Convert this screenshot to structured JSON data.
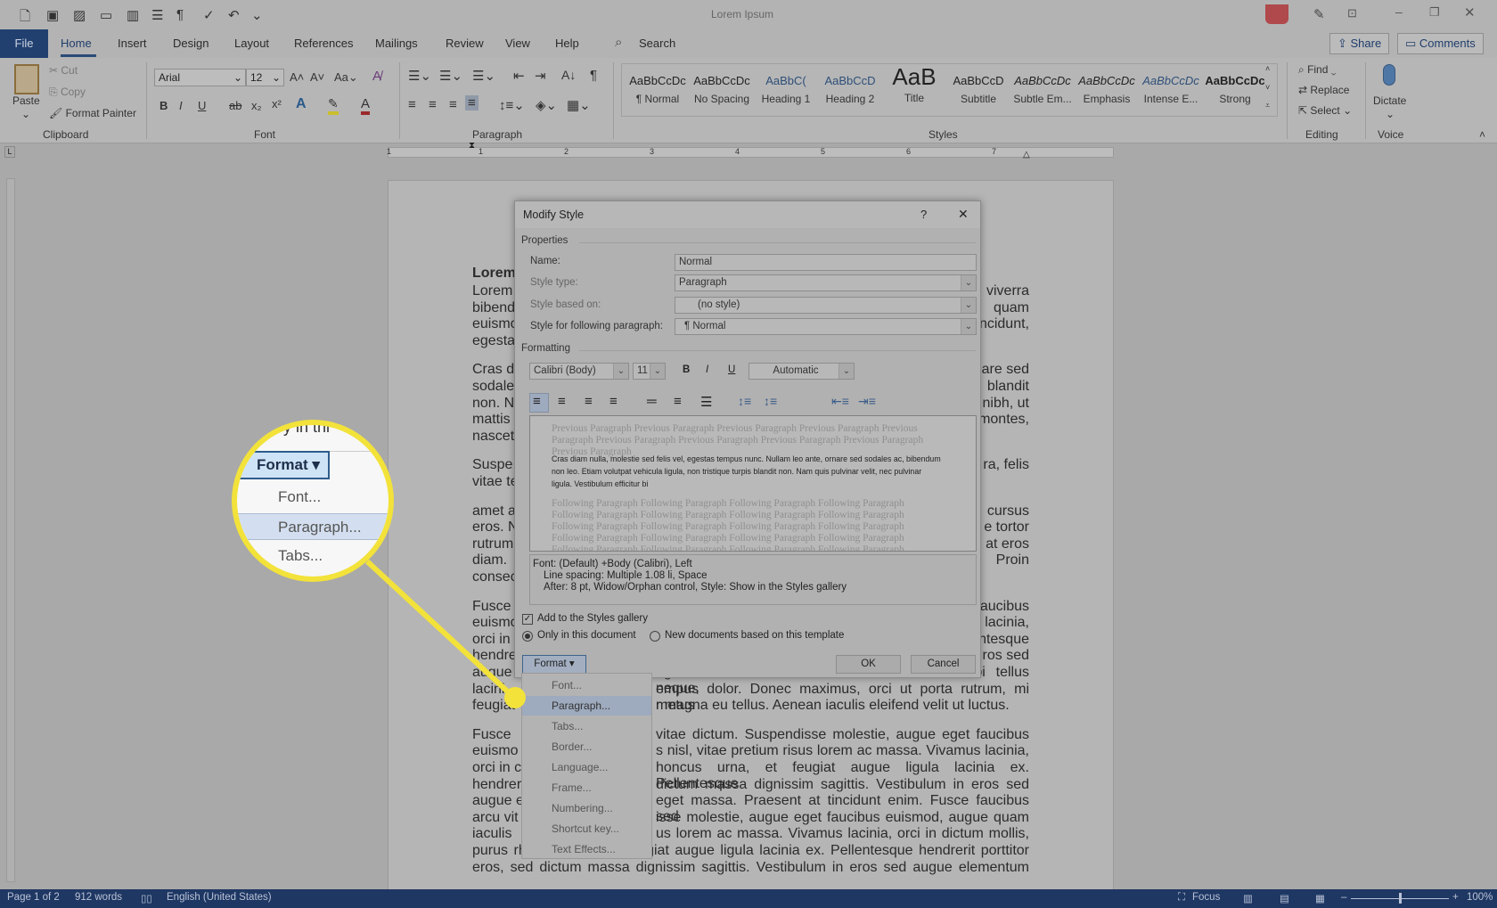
{
  "window": {
    "title": "Lorem Ipsum"
  },
  "quick_access": [
    {
      "icon": "new-document-icon",
      "glyph": "🗋"
    },
    {
      "icon": "save-icon",
      "glyph": "▣"
    },
    {
      "icon": "save-as-icon",
      "glyph": "▨"
    },
    {
      "icon": "open-folder-icon",
      "glyph": "▭"
    },
    {
      "icon": "read-mode-icon",
      "glyph": "▥"
    },
    {
      "icon": "print-layout-icon",
      "glyph": "☰"
    },
    {
      "icon": "pilcrow-icon",
      "glyph": "¶"
    },
    {
      "icon": "spelling-icon",
      "glyph": "✓"
    },
    {
      "icon": "undo-icon",
      "glyph": "↶"
    },
    {
      "icon": "customize-icon",
      "glyph": "⌄"
    }
  ],
  "tabs": {
    "file": "File",
    "items": [
      "Home",
      "Insert",
      "Design",
      "Layout",
      "References",
      "Mailings",
      "Review",
      "View",
      "Help"
    ],
    "active": "Home",
    "search": "Search"
  },
  "header_buttons": {
    "share": "Share",
    "comments": "Comments"
  },
  "clipboard": {
    "paste": "Paste",
    "cut": "Cut",
    "copy": "Copy",
    "format_painter": "Format Painter",
    "label": "Clipboard"
  },
  "font": {
    "name": "Arial",
    "size": "12",
    "label": "Font",
    "case": "Aa"
  },
  "paragraph": {
    "label": "Paragraph"
  },
  "styles": {
    "label": "Styles",
    "items": [
      {
        "preview": "AaBbCcDc",
        "name": "¶ Normal"
      },
      {
        "preview": "AaBbCcDc",
        "name": "No Spacing"
      },
      {
        "preview": "AaBbC(",
        "name": "Heading 1"
      },
      {
        "preview": "AaBbCcD",
        "name": "Heading 2"
      },
      {
        "preview": "AaB",
        "name": "Title"
      },
      {
        "preview": "AaBbCcD",
        "name": "Subtitle"
      },
      {
        "preview": "AaBbCcDc",
        "name": "Subtle Em..."
      },
      {
        "preview": "AaBbCcDc",
        "name": "Emphasis"
      },
      {
        "preview": "AaBbCcDc",
        "name": "Intense E..."
      },
      {
        "preview": "AaBbCcDc",
        "name": "Strong"
      }
    ]
  },
  "editing": {
    "find": "Find",
    "replace": "Replace",
    "select": "Select",
    "label": "Editing"
  },
  "voice": {
    "dictate": "Dictate",
    "label": "Voice"
  },
  "ruler": [
    "1",
    "1",
    "2",
    "3",
    "4",
    "5",
    "6",
    "7"
  ],
  "document": {
    "heading": "Lorem",
    "lines": [
      {
        "l": "Lorem",
        "r": "viverra"
      },
      {
        "l": "bibend",
        "r": "quam"
      },
      {
        "l": "euismo",
        "r": "tincidunt,"
      },
      {
        "l": "egesta",
        "r": ""
      },
      {
        "l": "Cras d",
        "r": "are sed"
      },
      {
        "l": "sodale",
        "r": "blandit"
      },
      {
        "l": "non. N",
        "r": "nibh, ut"
      },
      {
        "l": "mattis",
        "r": "montes,"
      },
      {
        "l": "nascet",
        "r": ""
      },
      {
        "l": "Suspe",
        "r": "ra, felis"
      },
      {
        "l": "vitae te",
        "r": ""
      },
      {
        "l": "amet a",
        "r": "cursus"
      },
      {
        "l": "eros. N",
        "r": "e tortor"
      },
      {
        "l": "rutrum",
        "r": "at eros"
      },
      {
        "l": "diam.",
        "r": "Proin"
      },
      {
        "l": "consec",
        "r": ""
      },
      {
        "l": "Fusce",
        "r": "aucibus"
      },
      {
        "l": "euismo",
        "r": "lacinia,"
      },
      {
        "l": "orci in",
        "r": "ntesque"
      },
      {
        "l": "hendre",
        "r": "ros sed"
      },
      {
        "l": "augue e",
        "r": "eget massa. Praesent at tincidunt enim. Morbi tellus neque,"
      },
      {
        "l": "lacini",
        "r": "empus dolor. Donec maximus, orci ut porta rutrum, mi metus"
      },
      {
        "l": "feugiat",
        "r": "r magna eu tellus. Aenean iaculis eleifend velit ut luctus."
      },
      {
        "l": "Fusce",
        "r": "vitae dictum. Suspendisse molestie, augue eget faucibus"
      },
      {
        "l": "euismo",
        "r": "s nisl, vitae pretium risus lorem ac massa. Vivamus lacinia,"
      },
      {
        "l": "orci in c",
        "r": "honcus urna, et feugiat augue ligula lacinia ex. Pellentesque"
      },
      {
        "l": "hendrer",
        "r": "dictum massa dignissim sagittis. Vestibulum in eros sed"
      },
      {
        "l": "augue e",
        "r": "eget massa. Praesent at tincidunt enim. Fusce faucibus sed"
      },
      {
        "l": "arcu vit",
        "r": "isse molestie, augue eget faucibus euismod, augue quam"
      },
      {
        "l": "iaculis",
        "r": "us lorem ac massa. Vivamus lacinia, orci in dictum mollis,"
      },
      {
        "l": "purus rhoncus urna, et feugiat augue ligula lacinia ex. Pellentesque hendrerit porttitor",
        "r": ""
      },
      {
        "l": "eros, sed dictum massa dignissim sagittis. Vestibulum in eros sed augue elementum",
        "r": ""
      }
    ]
  },
  "dialog": {
    "title": "Modify Style",
    "help": "?",
    "close": "✕",
    "properties": "Properties",
    "name_label": "Name:",
    "name_value": "Normal",
    "style_type_label": "Style type:",
    "style_type_value": "Paragraph",
    "based_on_label": "Style based on:",
    "based_on_value": "(no style)",
    "following_label": "Style for following paragraph:",
    "following_value": "¶  Normal",
    "formatting": "Formatting",
    "font": "Calibri (Body)",
    "size": "11",
    "bold": "B",
    "italic": "I",
    "underline": "U",
    "color": "Automatic",
    "preview_previous": "Previous Paragraph Previous Paragraph Previous Paragraph Previous Paragraph Previous Paragraph Previous Paragraph Previous Paragraph Previous Paragraph Previous Paragraph Previous Paragraph",
    "preview_sample": "Cras diam nulla, molestie sed felis vel, egestas tempus nunc. Nullam leo ante, ornare sed sodales ac, bibendum non leo. Etiam volutpat vehicula ligula, non tristique turpis blandit non. Nam quis pulvinar velit, nec pulvinar ligula. Vestibulum efficitur bi",
    "preview_following": "Following Paragraph Following Paragraph Following Paragraph Following Paragraph Following Paragraph Following Paragraph Following Paragraph Following Paragraph Following Paragraph Following Paragraph Following Paragraph Following Paragraph Following Paragraph Following Paragraph Following Paragraph Following Paragraph Following Paragraph Following Paragraph Following Paragraph Following Paragraph Following Paragraph Following Paragraph Following Paragraph Following Paragraph Following Paragraph",
    "description": [
      "Font: (Default) +Body (Calibri), Left",
      "Line spacing:  Multiple 1.08 li, Space",
      "After:  8 pt, Widow/Orphan control, Style: Show in the Styles gallery"
    ],
    "add_gallery": "Add to the Styles gallery",
    "add_gallery_checked": true,
    "only_doc": "Only in this document",
    "new_docs": "New documents based on this template",
    "scope_selected": "Only in this document",
    "format": "Format",
    "ok": "OK",
    "cancel": "Cancel"
  },
  "format_menu": {
    "items": [
      "Font...",
      "Paragraph...",
      "Tabs...",
      "Border...",
      "Language...",
      "Frame...",
      "Numbering...",
      "Shortcut key...",
      "Text Effects..."
    ],
    "highlighted": "Paragraph..."
  },
  "magnifier": {
    "partial_text": "y in thi",
    "format": "Format",
    "items": [
      "Font...",
      "Paragraph...",
      "Tabs..."
    ],
    "highlighted": "Paragraph..."
  },
  "status": {
    "page": "Page 1 of 2",
    "words": "912 words",
    "language": "English (United States)",
    "focus": "Focus",
    "zoom": "100%",
    "zoom_level": 100
  },
  "colors": {
    "accent": "#2b579a",
    "highlight": "#f2e23a"
  }
}
